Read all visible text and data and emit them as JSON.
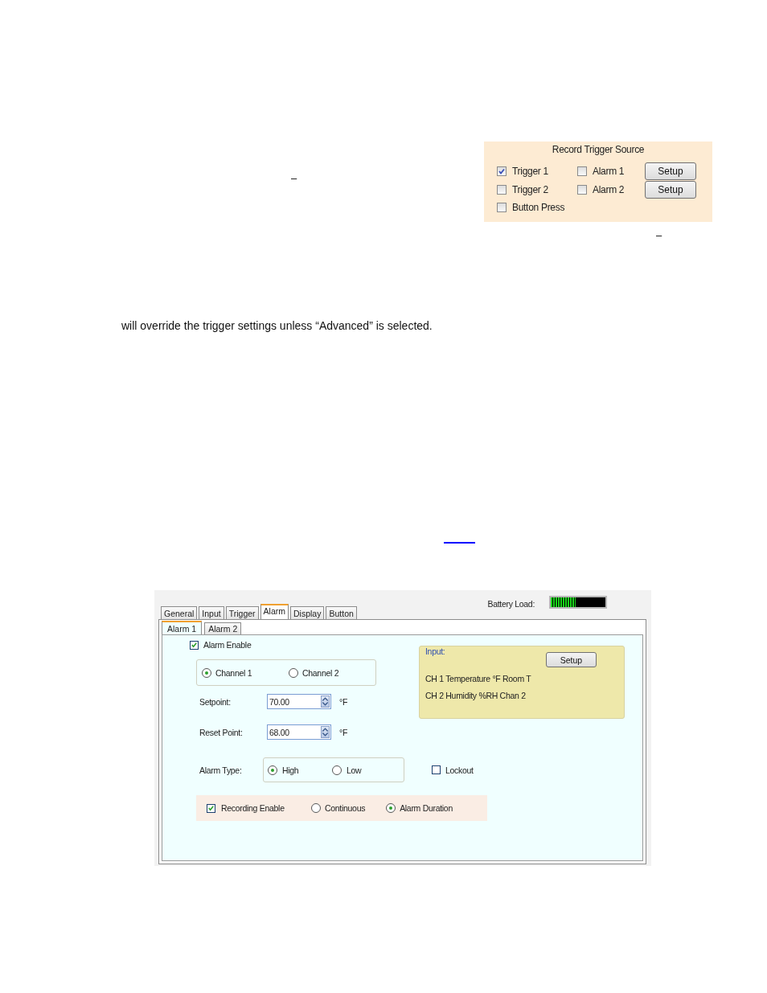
{
  "page": {
    "dash_top": "–",
    "dash_bottom": "–",
    "paragraph": "will override the trigger settings unless “Advanced” is selected."
  },
  "trigger_panel": {
    "title": "Record Trigger Source",
    "options": [
      {
        "label": "Trigger 1",
        "checked": true
      },
      {
        "label": "Trigger 2",
        "checked": false
      },
      {
        "label": "Button Press",
        "checked": false
      },
      {
        "label": "Alarm 1",
        "checked": false
      },
      {
        "label": "Alarm 2",
        "checked": false
      }
    ],
    "buttons": [
      "Setup",
      "Setup"
    ]
  },
  "dialog": {
    "battery": {
      "label": "Battery Load:",
      "level": 0.45
    },
    "tabs": [
      {
        "label": "General",
        "selected": false
      },
      {
        "label": "Input",
        "selected": false
      },
      {
        "label": "Trigger",
        "selected": false
      },
      {
        "label": "Alarm",
        "selected": true
      },
      {
        "label": "Display",
        "selected": false
      },
      {
        "label": "Button",
        "selected": false
      }
    ],
    "subtabs": [
      {
        "label": "Alarm 1",
        "selected": true
      },
      {
        "label": "Alarm 2",
        "selected": false
      }
    ],
    "alarm_enable": {
      "label": "Alarm Enable",
      "checked": true
    },
    "channels": [
      {
        "label": "Channel 1",
        "selected": true
      },
      {
        "label": "Channel 2",
        "selected": false
      }
    ],
    "setpoint": {
      "label": "Setpoint:",
      "value": "70.00",
      "unit": "°F"
    },
    "reset_point": {
      "label": "Reset Point:",
      "value": "68.00",
      "unit": "°F"
    },
    "alarm_type": {
      "label": "Alarm Type:",
      "options": [
        {
          "label": "High",
          "selected": true
        },
        {
          "label": "Low",
          "selected": false
        }
      ]
    },
    "lockout": {
      "label": "Lockout",
      "checked": false
    },
    "recording": {
      "label": "Recording Enable",
      "checked": true,
      "modes": [
        {
          "label": "Continuous",
          "selected": false
        },
        {
          "label": "Alarm Duration",
          "selected": true
        }
      ]
    },
    "input_group": {
      "legend": "Input:",
      "button": "Setup",
      "lines": [
        "CH 1 Temperature °F  Room T",
        "CH 2 Humidity %RH  Chan 2"
      ]
    }
  }
}
